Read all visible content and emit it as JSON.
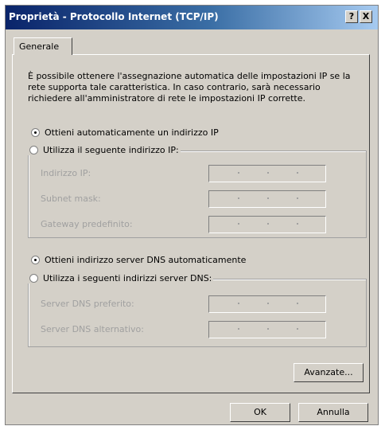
{
  "window": {
    "title": "Proprietà - Protocollo Internet (TCP/IP)",
    "help_label": "?",
    "close_label": "X"
  },
  "tabs": [
    {
      "label": "Generale"
    }
  ],
  "description": "È possibile ottenere l'assegnazione automatica delle impostazioni IP se la rete supporta tale caratteristica. In caso contrario, sarà necessario richiedere all'amministratore di rete le impostazioni IP corrette.",
  "ip": {
    "auto_label": "Ottieni automaticamente un indirizzo IP",
    "manual_label": "Utilizza il seguente indirizzo IP:",
    "selected": "auto",
    "fields": [
      {
        "label": "Indirizzo IP:",
        "value": ""
      },
      {
        "label": "Subnet mask:",
        "value": ""
      },
      {
        "label": "Gateway predefinito:",
        "value": ""
      }
    ]
  },
  "dns": {
    "auto_label": "Ottieni indirizzo server DNS automaticamente",
    "manual_label": "Utilizza i seguenti indirizzi server DNS:",
    "selected": "auto",
    "fields": [
      {
        "label": "Server DNS preferito:",
        "value": ""
      },
      {
        "label": "Server DNS alternativo:",
        "value": ""
      }
    ]
  },
  "buttons": {
    "advanced": "Avanzate...",
    "ok": "OK",
    "cancel": "Annulla"
  }
}
